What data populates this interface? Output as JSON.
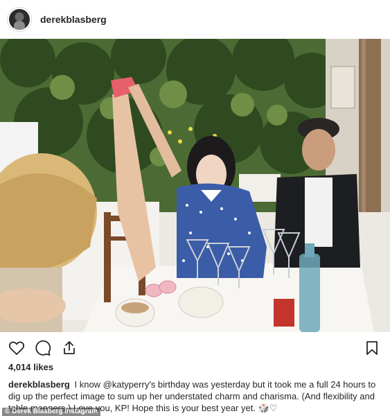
{
  "header": {
    "username": "derekblasberg",
    "avatar_icon": "profile-avatar"
  },
  "photo": {
    "description_icon": "post-photo"
  },
  "actions": {
    "like_icon": "heart-icon",
    "comment_icon": "comment-icon",
    "share_icon": "share-icon",
    "save_icon": "bookmark-icon"
  },
  "likes": "4,014 likes",
  "caption": {
    "username": "derekblasberg",
    "text": "I know @katyperry's birthday was yesterday but it took me a full 24 hours to dig up the perfect image to sum up her understated charm and charisma. (And flexibility and table manners.) Love you, KP! Hope this is your best year yet. 🎲♡"
  },
  "credit": "© Derek Blasberg Instagram",
  "colors": {
    "text": "#262626",
    "border": "#dbdbdb"
  }
}
